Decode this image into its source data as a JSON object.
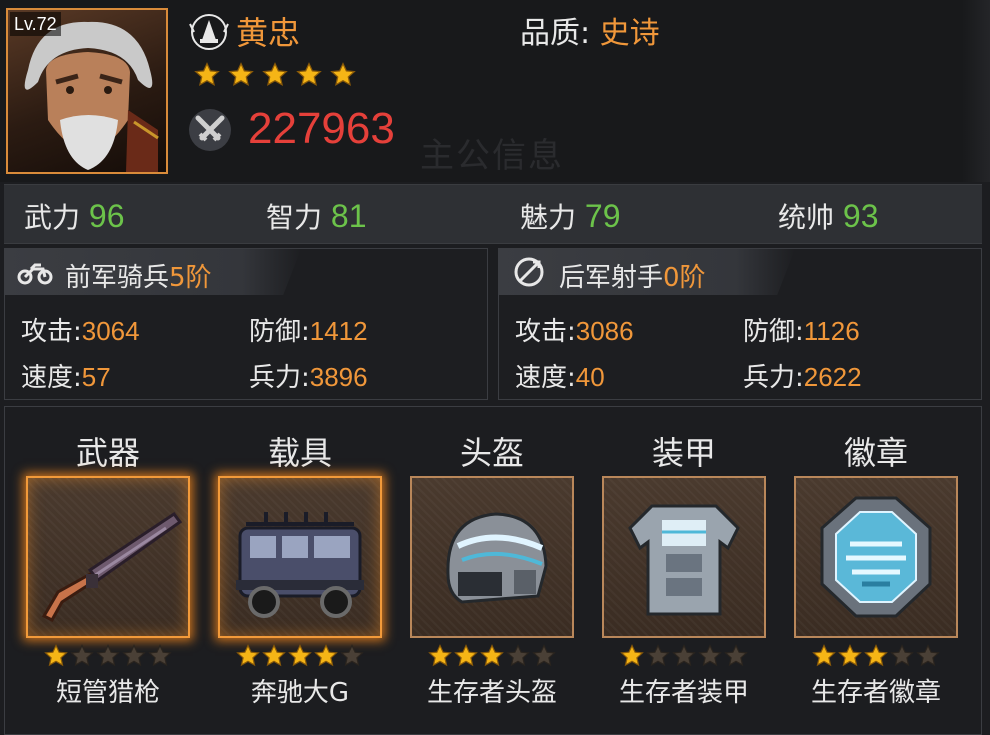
{
  "header": {
    "level": "Lv.72",
    "name": "黄忠",
    "star_count": 5,
    "power": "227963",
    "quality_label": "品质: ",
    "quality_value": "史诗",
    "watermark": "主公信息"
  },
  "attributes": [
    {
      "label": "武力",
      "value": "96"
    },
    {
      "label": "智力",
      "value": "81"
    },
    {
      "label": "魅力",
      "value": "79"
    },
    {
      "label": "统帅",
      "value": "93"
    }
  ],
  "troops": [
    {
      "title": "前军骑兵",
      "tier": "5阶",
      "attack_label": "攻击:",
      "attack": "3064",
      "defense_label": "防御:",
      "defense": "1412",
      "speed_label": "速度:",
      "speed": "57",
      "troops_label": "兵力:",
      "troops": "3896"
    },
    {
      "title": "后军射手",
      "tier": "0阶",
      "attack_label": "攻击:",
      "attack": "3086",
      "defense_label": "防御:",
      "defense": "1126",
      "speed_label": "速度:",
      "speed": "40",
      "troops_label": "兵力:",
      "troops": "2622"
    }
  ],
  "equipment": [
    {
      "slot": "武器",
      "name": "短管猎枪",
      "stars": 1,
      "icon": "shotgun-icon"
    },
    {
      "slot": "载具",
      "name": "奔驰大G",
      "stars": 4,
      "icon": "suv-icon"
    },
    {
      "slot": "头盔",
      "name": "生存者头盔",
      "stars": 3,
      "icon": "helmet-icon"
    },
    {
      "slot": "装甲",
      "name": "生存者装甲",
      "stars": 1,
      "icon": "armor-icon"
    },
    {
      "slot": "徽章",
      "name": "生存者徽章",
      "stars": 3,
      "icon": "badge-icon"
    }
  ],
  "colors": {
    "accent_orange": "#f0973a",
    "power_red": "#e5403a",
    "stat_green": "#6cc34a",
    "star_gold": "#f5b516",
    "star_empty": "#4a4036"
  }
}
